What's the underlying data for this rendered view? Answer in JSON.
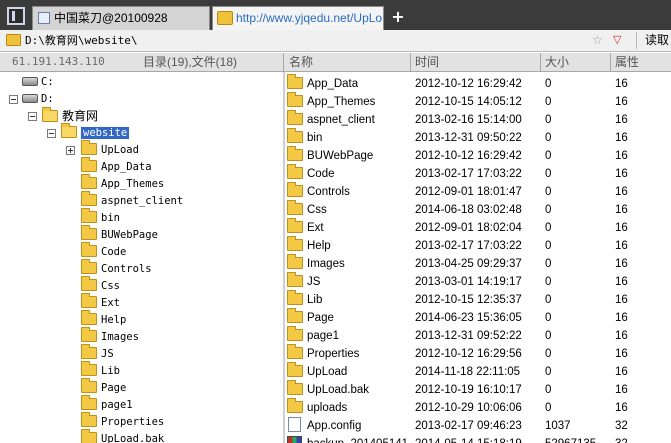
{
  "tabs": [
    {
      "label": "中国菜刀@20100928"
    },
    {
      "label": "http://www.yjqedu.net/UpLo..."
    }
  ],
  "new_tab_symbol": "+",
  "address": {
    "path": "D:\\教育网\\website\\",
    "fav_symbol": "☆",
    "dropdown_symbol": "▽",
    "read_button": "读取"
  },
  "info": {
    "ip": "61.191.143.110",
    "summary": "目录(19),文件(18)"
  },
  "columns": {
    "name": "名称",
    "time": "时间",
    "size": "大小",
    "attr": "属性"
  },
  "tree": {
    "drives": [
      "C:",
      "D:"
    ],
    "root_folder": "教育网",
    "current_folder": "website",
    "children": [
      "UpLoad",
      "App_Data",
      "App_Themes",
      "aspnet_client",
      "bin",
      "BUWebPage",
      "Code",
      "Controls",
      "Css",
      "Ext",
      "Help",
      "Images",
      "JS",
      "Lib",
      "Page",
      "page1",
      "Properties",
      "UpLoad.bak"
    ]
  },
  "files": [
    {
      "name": "App_Data",
      "time": "2012-10-12 16:29:42",
      "size": "0",
      "attr": "16"
    },
    {
      "name": "App_Themes",
      "time": "2012-10-15 14:05:12",
      "size": "0",
      "attr": "16"
    },
    {
      "name": "aspnet_client",
      "time": "2013-02-16 15:14:00",
      "size": "0",
      "attr": "16"
    },
    {
      "name": "bin",
      "time": "2013-12-31 09:50:22",
      "size": "0",
      "attr": "16"
    },
    {
      "name": "BUWebPage",
      "time": "2012-10-12 16:29:42",
      "size": "0",
      "attr": "16"
    },
    {
      "name": "Code",
      "time": "2013-02-17 17:03:22",
      "size": "0",
      "attr": "16"
    },
    {
      "name": "Controls",
      "time": "2012-09-01 18:01:47",
      "size": "0",
      "attr": "16"
    },
    {
      "name": "Css",
      "time": "2014-06-18 03:02:48",
      "size": "0",
      "attr": "16"
    },
    {
      "name": "Ext",
      "time": "2012-09-01 18:02:04",
      "size": "0",
      "attr": "16"
    },
    {
      "name": "Help",
      "time": "2013-02-17 17:03:22",
      "size": "0",
      "attr": "16"
    },
    {
      "name": "Images",
      "time": "2013-04-25 09:29:37",
      "size": "0",
      "attr": "16"
    },
    {
      "name": "JS",
      "time": "2013-03-01 14:19:17",
      "size": "0",
      "attr": "16"
    },
    {
      "name": "Lib",
      "time": "2012-10-15 12:35:37",
      "size": "0",
      "attr": "16"
    },
    {
      "name": "Page",
      "time": "2014-06-23 15:36:05",
      "size": "0",
      "attr": "16"
    },
    {
      "name": "page1",
      "time": "2013-12-31 09:52:22",
      "size": "0",
      "attr": "16"
    },
    {
      "name": "Properties",
      "time": "2012-10-12 16:29:56",
      "size": "0",
      "attr": "16"
    },
    {
      "name": "UpLoad",
      "time": "2014-11-18 22:11:05",
      "size": "0",
      "attr": "16"
    },
    {
      "name": "UpLoad.bak",
      "time": "2012-10-19 16:10:17",
      "size": "0",
      "attr": "16"
    },
    {
      "name": "uploads",
      "time": "2012-10-29 10:06:06",
      "size": "0",
      "attr": "16"
    },
    {
      "name": "App.config",
      "time": "2013-02-17 09:46:23",
      "size": "1037",
      "attr": "32",
      "type": "file"
    },
    {
      "name": "backup_201405141...",
      "time": "2014-05-14 15:18:19",
      "size": "52967135",
      "attr": "32",
      "type": "archive"
    }
  ]
}
